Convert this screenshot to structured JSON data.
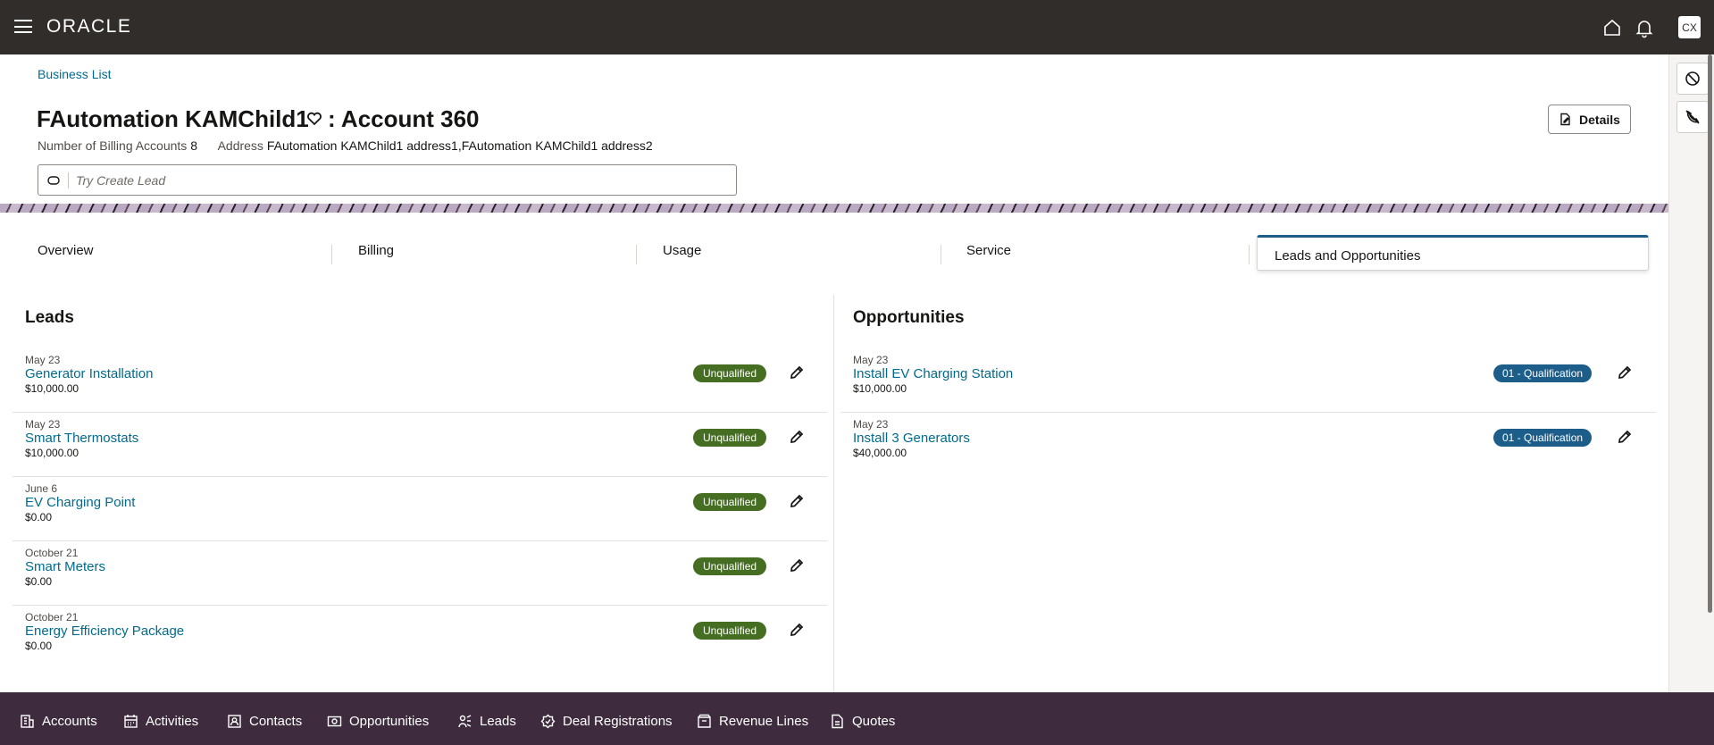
{
  "app": {
    "logo_text": "ORACLE",
    "user_initials": "CX"
  },
  "breadcrumb": "Business List",
  "header": {
    "title": "FAutomation KAMChild1",
    "title_suffix": ": Account 360",
    "billing_label": "Number of Billing Accounts",
    "billing_value": "8",
    "address_label": "Address",
    "address_value": "FAutomation KAMChild1 address1,FAutomation KAMChild1 address2",
    "details_label": "Details"
  },
  "lead_input": {
    "placeholder": "Try Create Lead"
  },
  "tabs": [
    {
      "label": "Overview"
    },
    {
      "label": "Billing"
    },
    {
      "label": "Usage"
    },
    {
      "label": "Service"
    },
    {
      "label": "Leads and Opportunities",
      "active": true
    }
  ],
  "leads": {
    "title": "Leads",
    "items": [
      {
        "date": "May 23",
        "name": "Generator Installation",
        "amount": "$10,000.00",
        "status": "Unqualified"
      },
      {
        "date": "May 23",
        "name": "Smart Thermostats",
        "amount": "$10,000.00",
        "status": "Unqualified"
      },
      {
        "date": "June 6",
        "name": "EV Charging Point",
        "amount": "$0.00",
        "status": "Unqualified"
      },
      {
        "date": "October 21",
        "name": "Smart Meters",
        "amount": "$0.00",
        "status": "Unqualified"
      },
      {
        "date": "October 21",
        "name": "Energy Efficiency Package",
        "amount": "$0.00",
        "status": "Unqualified"
      }
    ]
  },
  "opportunities": {
    "title": "Opportunities",
    "items": [
      {
        "date": "May 23",
        "name": "Install EV Charging Station",
        "amount": "$10,000.00",
        "status": "01 - Qualification"
      },
      {
        "date": "May 23",
        "name": "Install 3 Generators",
        "amount": "$40,000.00",
        "status": "01 - Qualification"
      }
    ]
  },
  "bottom_nav": [
    {
      "label": "Accounts",
      "icon": "building-icon"
    },
    {
      "label": "Activities",
      "icon": "calendar-icon"
    },
    {
      "label": "Contacts",
      "icon": "contact-card-icon"
    },
    {
      "label": "Opportunities",
      "icon": "opportunity-icon"
    },
    {
      "label": "Leads",
      "icon": "leads-icon"
    },
    {
      "label": "Deal Registrations",
      "icon": "deal-icon"
    },
    {
      "label": "Revenue Lines",
      "icon": "revenue-icon"
    },
    {
      "label": "Quotes",
      "icon": "quotes-icon"
    }
  ],
  "colors": {
    "topbar": "#312d2a",
    "bottom_nav": "#3e2c3e",
    "link": "#006b8f",
    "unqualified_badge": "#466e23",
    "qualification_badge": "#1c5d89"
  }
}
